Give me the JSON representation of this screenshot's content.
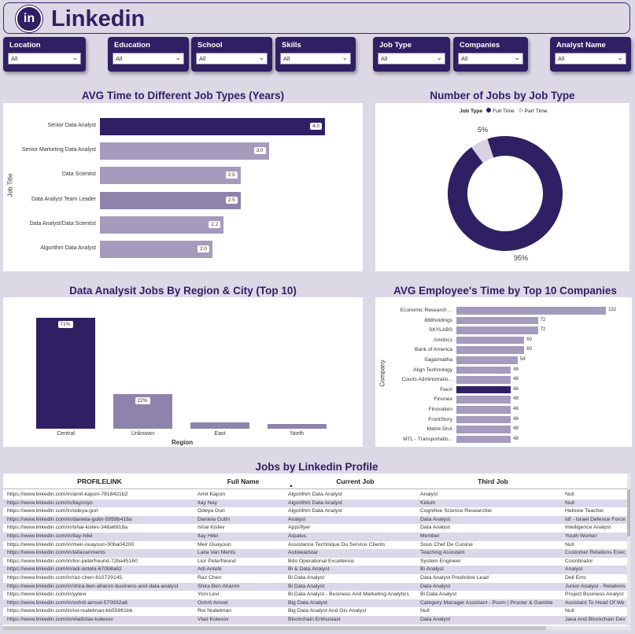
{
  "app": {
    "title": "Linkedin",
    "logo_text": "in"
  },
  "colors": {
    "accent": "#2f1f63",
    "background": "#dcd8e6"
  },
  "slicers": [
    {
      "label": "Location",
      "value": "All"
    },
    {
      "label": "Education",
      "value": "All"
    },
    {
      "label": "School",
      "value": "All"
    },
    {
      "label": "Skills",
      "value": "All"
    },
    {
      "label": "Job Type",
      "value": "All"
    },
    {
      "label": "Companies",
      "value": "All"
    },
    {
      "label": "Analyst Name",
      "value": "All"
    }
  ],
  "chart1": {
    "title": "AVG Time to Different Job Types (Years)"
  },
  "chart2": {
    "title": "Number of Jobs by Job Type"
  },
  "chart3": {
    "title": "Data Analysit Jobs By Region & City (Top 10)"
  },
  "chart4": {
    "title": "AVG Employee's Time by Top 10 Companies"
  },
  "chart_data": [
    {
      "type": "bar",
      "orientation": "horizontal",
      "title": "AVG Time to Different Job Types (Years)",
      "ylabel": "Job Title",
      "categories": [
        "Senior Data Analyst",
        "Senior Marketing Data Analyst",
        "Data Scientist",
        "Data Analyst Team Leader",
        "Data Analyst/Data Scientist",
        "Algorithm Data Analyst"
      ],
      "values": [
        4.0,
        3.0,
        2.5,
        2.5,
        2.2,
        2.0
      ],
      "labels": [
        "4.0",
        "3.0",
        "2.5",
        "2.5",
        "2.2",
        "2.0"
      ],
      "colors": [
        "#2f1f63",
        "#a59bbd",
        "#a59bbd",
        "#8e83ab",
        "#a59bbd",
        "#a59bbd"
      ],
      "xlim": [
        0,
        5
      ]
    },
    {
      "type": "pie",
      "title": "Number of Jobs by Job Type",
      "legend_title": "Job Type",
      "legend_position": "top",
      "categories": [
        "Full Time",
        "Part Time"
      ],
      "values": [
        95,
        5
      ],
      "labels": [
        "95%",
        "5%"
      ],
      "colors": [
        "#2f1f63",
        "#d6d2e3"
      ]
    },
    {
      "type": "bar",
      "title": "Data Analysit Jobs By Region & City (Top 10)",
      "xlabel": "Region",
      "categories": [
        "Central",
        "Unknown",
        "East",
        "North"
      ],
      "values": [
        71,
        22,
        4,
        3
      ],
      "labels": [
        "71%",
        "22%",
        "",
        ""
      ],
      "colors": [
        "#2f1f63",
        "#8e83ab",
        "#8e83ab",
        "#8e83ab"
      ],
      "ylim": [
        0,
        80
      ]
    },
    {
      "type": "bar",
      "orientation": "horizontal",
      "title": "AVG Employee's Time by Top 10 Companies",
      "ylabel": "Company",
      "categories": [
        "Economic Research ...",
        "888holdings",
        "SKYLABS",
        "Amdocs",
        "Bank of America",
        "Sagarmatha",
        "Align Technology",
        "Courts Administratio...",
        "FeeX",
        "Finonex",
        "Finovation",
        "FrontStory",
        "Matrix DnA",
        "MTL - Transportatio..."
      ],
      "values": [
        132,
        72,
        72,
        60,
        60,
        54,
        48,
        48,
        48,
        48,
        48,
        48,
        48,
        48
      ],
      "labels": [
        "132",
        "72",
        "72",
        "60",
        "60",
        "54",
        "48",
        "48",
        "48",
        "48",
        "48",
        "48",
        "48",
        "48"
      ],
      "highlight_index": 8,
      "colors": {
        "bar": "#a59bbd",
        "highlight": "#2f1f63"
      },
      "xlim": [
        0,
        140
      ]
    }
  ],
  "table": {
    "title": "Jobs by Linkedin Profile",
    "columns": [
      "PROFILELINK",
      "Full Name",
      "Current Job",
      "Third Job",
      ""
    ],
    "sort_icon": "▲",
    "rows": [
      [
        "https://www.linkedin.com/in/amit-kapon-7818421b2",
        "Amit Kapon",
        "Algorithm Data Analyst",
        "Analyst",
        "Null"
      ],
      [
        "https://www.linkedin.com/in/itaynoyo",
        "Itay Noy",
        "Algorithm Data Analyst",
        "Kidum",
        "Null"
      ],
      [
        "https://www.linkedin.com/in/odeya-guri",
        "Odeya Guri",
        "Algorithm Data Analyst",
        "Cognitive Science Researcher",
        "Hebrew Teacher"
      ],
      [
        "https://www.linkedin.com/in/daniela-gutin-5958b418a",
        "Daniela Gutin",
        "Analyst",
        "Data Analyst",
        "Idf - Israel Defence Force"
      ],
      [
        "https://www.linkedin.com/in/ishai-kislev-348a6918a",
        "Ishai Kislev",
        "Appsflyer",
        "Data Analyst",
        "Intelligence Analyst"
      ],
      [
        "https://www.linkedin.com/in/itay-hilel",
        "Itay Hilel",
        "Arpalus",
        "Member",
        "Youth Worker"
      ],
      [
        "https://www.linkedin.com/in/meir-ouayoun-90ba04200",
        "Meir Ouayoun",
        "Assistance Technique Du Service Clients",
        "Sous Chef De Cuisine",
        "Null"
      ],
      [
        "https://www.linkedin.com/in/lailavanments",
        "Laila Van Ments",
        "Autoleadstar",
        "Teaching Assistant",
        "Customer Relations Exec"
      ],
      [
        "https://www.linkedin.com/in/lior-peterfreund-72ba45160",
        "Lior Peterfreund",
        "Bdo Operational Excellence",
        "System Engineer",
        "Coordinator"
      ],
      [
        "https://www.linkedin.com/in/adi-antebi-670b8a62",
        "Adi Antebi",
        "Bi & Data Analyst",
        "Bi Analyst",
        "Analyst"
      ],
      [
        "https://www.linkedin.com/in/raz-chen-610729145",
        "Raz Chen",
        "Bi Data Analyst",
        "Data Analyst Predictive Lead",
        "Dell Emc"
      ],
      [
        "https://www.linkedin.com/in/shira-ben-aharon-business-and-data-analyst",
        "Shira Ben Aharon",
        "Bi Data Analyst",
        "Data Analyst",
        "Junior Analyst - Relations"
      ],
      [
        "https://www.linkedin.com/in/yylevi",
        "Yoni Levi",
        "Bi Data Analyst - Business And Marketing Analytics",
        "Bi Data Analyst",
        "Project Business Analyst"
      ],
      [
        "https://www.linkedin.com/in/oshrit-amsel-570932a6",
        "Oshrit Amsel",
        "Big Data Analyst",
        "Category Manager Assistant - Posm | Procter & Gamble",
        "Assistant To Head Of We"
      ],
      [
        "https://www.linkedin.com/in/roi-nudelman-bb55961bb",
        "Roi Nudelman",
        "Big Data Analyst And Gis Analyst",
        "Null",
        "Null"
      ],
      [
        "https://www.linkedin.com/in/vladislav-kolesov",
        "Vlad Kolesov",
        "Blockchain Enthusiast",
        "Data Analyst",
        "Java And Blockchain Dev"
      ]
    ]
  }
}
